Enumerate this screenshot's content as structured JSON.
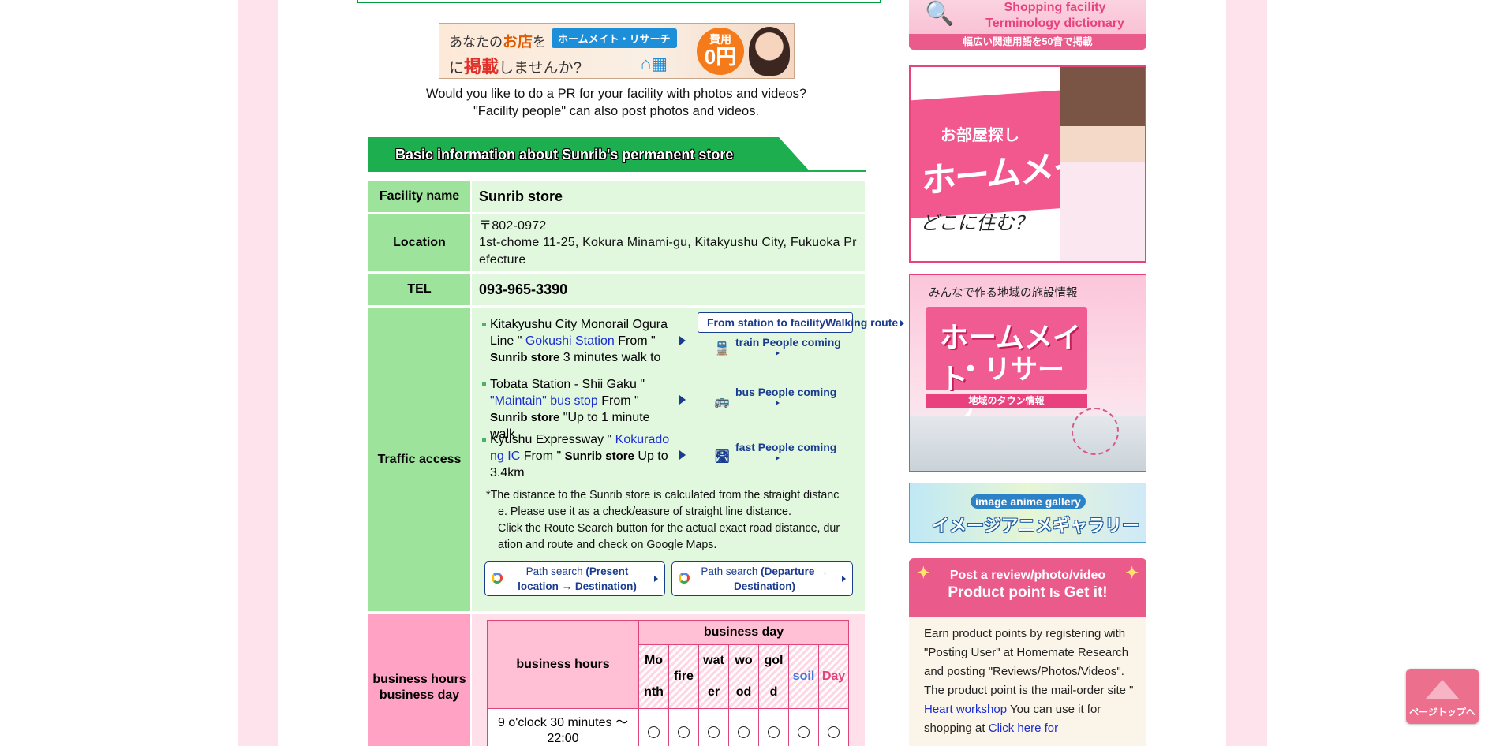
{
  "ad_banner": {
    "line1_prefix": "あなたの",
    "line1_shop": "お店",
    "line1_mid": "を",
    "pill": "ホームメイト・リサーチ",
    "line2_prefix": "に",
    "line2_emph": "掲載",
    "line2_suffix": "しませんか?",
    "coin_top": "費用",
    "coin_bottom": "0円"
  },
  "pr_text": {
    "line1": "Would you like to do a PR for your facility with photos and videos?",
    "line2": "\"Facility people\" can also post photos and videos."
  },
  "section_title": "Basic information about Sunrib's permanent store",
  "facility": {
    "name_label": "Facility name",
    "name": "Sunrib store",
    "location_label": "Location",
    "postal": "〒802-0972",
    "address": "1st-chome 11-25, Kokura Minami-gu, Kitakyushu City, Fukuoka Prefecture",
    "tel_label": "TEL",
    "tel": "093-965-3390",
    "traffic_label": "Traffic access",
    "route_button": "From station to facilityWalking route",
    "access": [
      {
        "pre": "Kitakyushu City Monorail Ogura Line \" ",
        "link": "Gokushi Station",
        "mid": " From \" ",
        "bold": "Sunrib store",
        "post": " 3 minutes walk to",
        "count_icon": "train-icon",
        "count_label": "train People coming"
      },
      {
        "pre": "Tobata Station  -  Shii Gaku \" ",
        "link": "\"Maintain\" bus stop",
        "mid": " From \" ",
        "bold": "Sunrib store",
        "post": " \"Up to 1 minute walk",
        "count_icon": "bus-icon",
        "count_label": "bus People coming"
      },
      {
        "pre": "Kyushu Expressway \" ",
        "link": "Kokurado ng IC",
        "mid": " From \" ",
        "bold": "Sunrib store",
        "post": " Up to 3.4km",
        "count_icon": "highway-icon",
        "count_label": "fast People coming"
      }
    ],
    "note_line1": "*The distance to the Sunrib store is calculated from the straight distanc",
    "note_line2": "e. Please use it as a check/easure of straight line distance.",
    "note_line3": "Click the Route Search button for the actual exact road distance, dur",
    "note_line4": "ation and route and check on Google Maps.",
    "path_btn1_pre": "Path search ",
    "path_btn1_bold": "(Present location → Destination)",
    "path_btn2_pre": "Path search ",
    "path_btn2_bold": "(Departure → Destination)"
  },
  "hours": {
    "label_line1": "business hours",
    "label_line2": "business day",
    "col_hours": "business hours",
    "col_days": "business day",
    "days": [
      {
        "top": "Mo",
        "bottom": "nth"
      },
      {
        "top": "",
        "bottom": "fire"
      },
      {
        "top": "wat",
        "bottom": "er"
      },
      {
        "top": "wo",
        "bottom": "od"
      },
      {
        "top": "gol",
        "bottom": "d"
      },
      {
        "top": "",
        "bottom": "soil"
      },
      {
        "top": "",
        "bottom": "Day"
      }
    ],
    "row_time": "9 o'clock 30 minutes ～ 22:00",
    "row_marks": [
      "○",
      "○",
      "○",
      "○",
      "○",
      "○",
      "○"
    ]
  },
  "right": {
    "dict_title1": "Shopping facility",
    "dict_title2": "Terminology dictionary",
    "dict_sub": "幅広い関連用語を50音で掲載",
    "homemate_small": "お部屋探し",
    "homemate_big": "ホームメイト",
    "homemate_script": "どこに住む？",
    "research_head": "みんなで作る地域の施設情報",
    "research_logo1": "ホームメイト",
    "research_logo2": "・リサーチ",
    "research_tag": "地域のタウン情報",
    "gallery_en": "image anime gallery",
    "gallery_jp": "イメージアニメギャラリー",
    "post_head1": "Post a review/photo/video",
    "post_head2a": "Product point ",
    "post_head2b": "Is",
    "post_head2c": " Get it!",
    "post_body1": "Earn product points by registering with \"Posting User\" at Homemate Research and posting \"Reviews/Photos/Videos\".",
    "post_body2_pre": "The product point is the mail-order site \" ",
    "post_body2_link": "Heart workshop",
    "post_body2_post": " You can use it for shopping at ",
    "post_body2_link2": "Click here for"
  },
  "page_top_label": "ページトップへ",
  "colors": {
    "green_header": "#1cae4f",
    "label_green": "#9ee39b",
    "value_green": "#e1f8df",
    "pink": "#ffa2c4",
    "link_blue": "#1a2ed0",
    "nav_blue": "#1a3c8f"
  }
}
